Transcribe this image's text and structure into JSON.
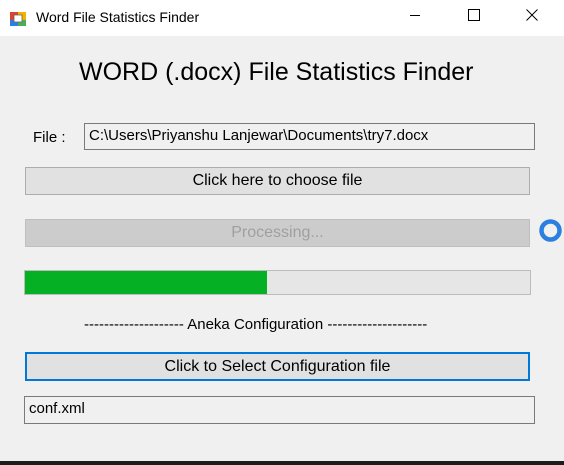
{
  "window": {
    "title": "Word File Statistics Finder"
  },
  "titlebar": {
    "app_icon": "app-icon",
    "minimize_icon": "minimize-icon",
    "maximize_icon": "maximize-icon",
    "close_icon": "close-icon"
  },
  "main": {
    "heading": "WORD (.docx) File Statistics Finder",
    "file_label": "File :",
    "file_path": "C:\\Users\\Priyanshu Lanjewar\\Documents\\try7.docx",
    "choose_button_label": "Click here to choose file",
    "processing_label": "Processing...",
    "spinner_icon": "spinner-icon",
    "progress_fraction": 0.48,
    "separator_text": "-------------------- Aneka Configuration --------------------",
    "config_button_label": "Click to Select Configuration file",
    "config_file": "conf.xml"
  },
  "colors": {
    "window_bg": "#f0f0f0",
    "titlebar_bg": "#ffffff",
    "progress_fill": "#06b025",
    "focus_border": "#0078d7",
    "spinner": "#2a7fe0"
  }
}
